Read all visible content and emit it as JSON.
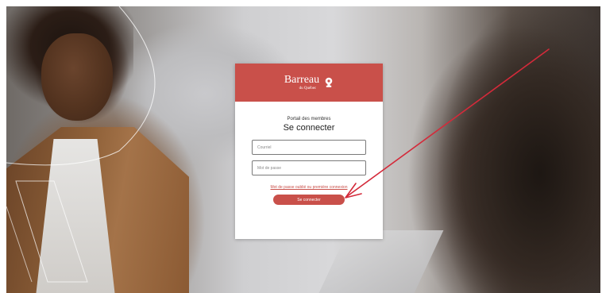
{
  "brand": {
    "name": "Barreau",
    "sub": "du Québec"
  },
  "login": {
    "subtitle": "Portail des membres",
    "title": "Se connecter",
    "email_placeholder": "Courriel",
    "password_placeholder": "Mot de passe",
    "forgot_link": "Mot de passe oublié ou première connexion",
    "submit_label": "Se connecter"
  },
  "colors": {
    "brand_red": "#c9504a",
    "annotation_arrow": "#d42a3a"
  },
  "icons": {
    "brand_logo": "pawn-seal-icon"
  }
}
